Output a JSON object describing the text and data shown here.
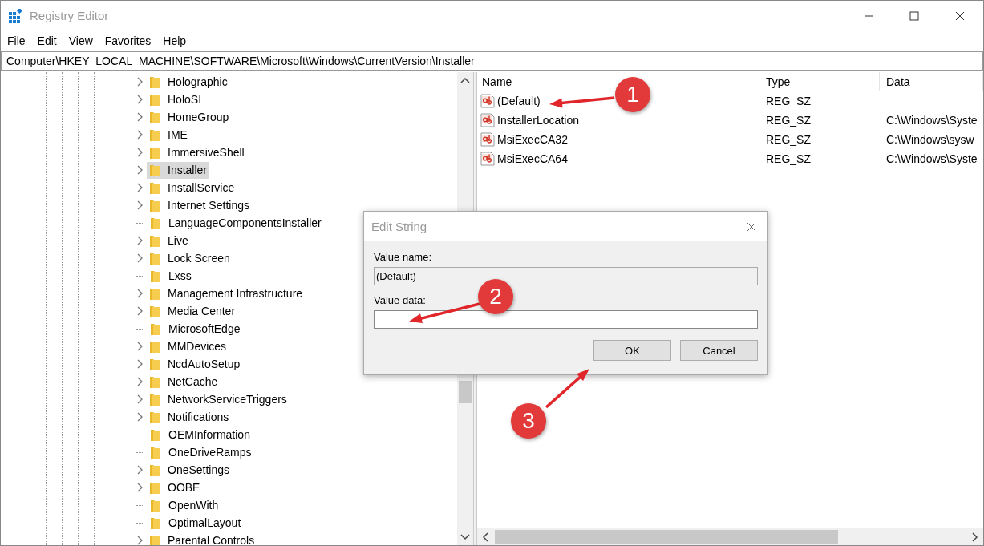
{
  "window": {
    "title": "Registry Editor"
  },
  "menu": [
    "File",
    "Edit",
    "View",
    "Favorites",
    "Help"
  ],
  "address": "Computer\\HKEY_LOCAL_MACHINE\\SOFTWARE\\Microsoft\\Windows\\CurrentVersion\\Installer",
  "tree": {
    "items": [
      {
        "label": "Holographic",
        "expandable": true,
        "selected": false
      },
      {
        "label": "HoloSI",
        "expandable": true,
        "selected": false
      },
      {
        "label": "HomeGroup",
        "expandable": true,
        "selected": false
      },
      {
        "label": "IME",
        "expandable": true,
        "selected": false
      },
      {
        "label": "ImmersiveShell",
        "expandable": true,
        "selected": false
      },
      {
        "label": "Installer",
        "expandable": true,
        "selected": true
      },
      {
        "label": "InstallService",
        "expandable": true,
        "selected": false
      },
      {
        "label": "Internet Settings",
        "expandable": true,
        "selected": false
      },
      {
        "label": "LanguageComponentsInstaller",
        "expandable": false,
        "selected": false
      },
      {
        "label": "Live",
        "expandable": true,
        "selected": false
      },
      {
        "label": "Lock Screen",
        "expandable": true,
        "selected": false
      },
      {
        "label": "Lxss",
        "expandable": false,
        "selected": false
      },
      {
        "label": "Management Infrastructure",
        "expandable": true,
        "selected": false
      },
      {
        "label": "Media Center",
        "expandable": true,
        "selected": false
      },
      {
        "label": "MicrosoftEdge",
        "expandable": false,
        "selected": false
      },
      {
        "label": "MMDevices",
        "expandable": true,
        "selected": false
      },
      {
        "label": "NcdAutoSetup",
        "expandable": true,
        "selected": false
      },
      {
        "label": "NetCache",
        "expandable": true,
        "selected": false
      },
      {
        "label": "NetworkServiceTriggers",
        "expandable": true,
        "selected": false
      },
      {
        "label": "Notifications",
        "expandable": true,
        "selected": false
      },
      {
        "label": "OEMInformation",
        "expandable": false,
        "selected": false
      },
      {
        "label": "OneDriveRamps",
        "expandable": false,
        "selected": false
      },
      {
        "label": "OneSettings",
        "expandable": true,
        "selected": false
      },
      {
        "label": "OOBE",
        "expandable": true,
        "selected": false
      },
      {
        "label": "OpenWith",
        "expandable": false,
        "selected": false
      },
      {
        "label": "OptimalLayout",
        "expandable": false,
        "selected": false
      },
      {
        "label": "Parental Controls",
        "expandable": true,
        "selected": false
      }
    ]
  },
  "values": {
    "columns": [
      "Name",
      "Type",
      "Data"
    ],
    "rows": [
      {
        "name": "(Default)",
        "type": "REG_SZ"
      },
      {
        "name": "InstallerLocation",
        "type": "REG_SZ",
        "data": "C:\\Windows\\Syste"
      },
      {
        "name": "MsiExecCA32",
        "type": "REG_SZ",
        "data": "C:\\Windows\\sysw"
      },
      {
        "name": "MsiExecCA64",
        "type": "REG_SZ",
        "data": "C:\\Windows\\Syste"
      }
    ]
  },
  "dialog": {
    "title": "Edit String",
    "value_name_label": "Value name:",
    "value_name": "(Default)",
    "value_data_label": "Value data:",
    "buttons": [
      "OK",
      "Cancel"
    ]
  },
  "annotations": [
    {
      "number": "1"
    },
    {
      "number": "2"
    },
    {
      "number": "3"
    }
  ]
}
